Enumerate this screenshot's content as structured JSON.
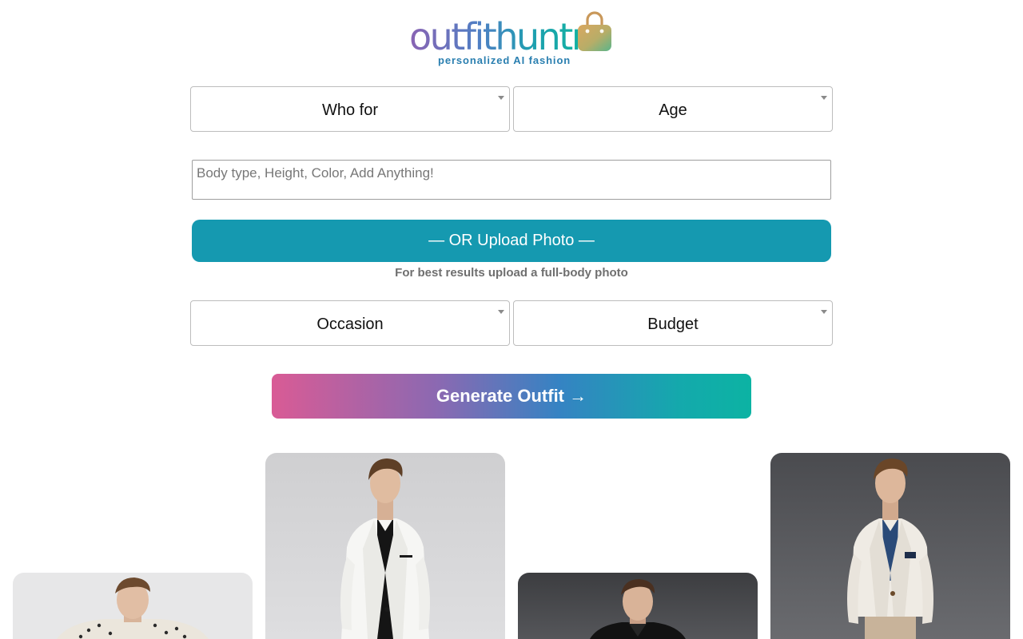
{
  "brand": {
    "name": "outfithuntr",
    "tagline": "personalized AI fashion"
  },
  "form": {
    "who_for": {
      "selected": "Who for"
    },
    "age": {
      "selected": "Age"
    },
    "details": {
      "placeholder": "Body type, Height, Color, Add Anything!",
      "value": ""
    },
    "upload": {
      "label": "— OR Upload Photo —",
      "hint": "For best results upload a full-body photo"
    },
    "occasion": {
      "selected": "Occasion"
    },
    "budget": {
      "selected": "Budget"
    },
    "generate": {
      "label": "Generate Outfit →"
    }
  },
  "gallery": {
    "items": [
      {
        "name": "outfit-patterned-shirt"
      },
      {
        "name": "outfit-white-suit-black-shirt"
      },
      {
        "name": "outfit-black-jacket"
      },
      {
        "name": "outfit-white-blazer-blue-shirt"
      }
    ]
  },
  "colors": {
    "upload_button": "#1599b0",
    "generate_gradient": [
      "#d95b95",
      "#8a69b2",
      "#3583c3",
      "#14a9ac",
      "#0cb3a3"
    ],
    "hint_text": "#6f6f6f"
  }
}
